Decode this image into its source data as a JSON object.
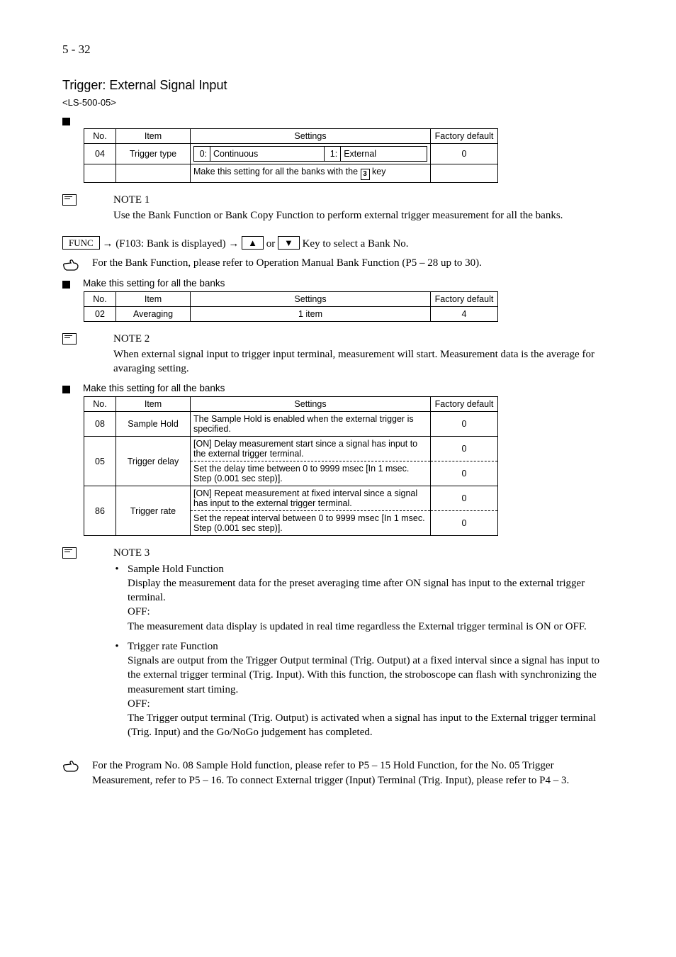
{
  "page_label": "5 - 32",
  "title": "Trigger: External Signal Input",
  "subtitle": "<LS-500-05>",
  "t1": {
    "headers": [
      "No.",
      "Item",
      "Settings",
      "Factory default"
    ],
    "row1": {
      "no": "04",
      "item": "Trigger type",
      "set_l_n": "0:",
      "set_l_v": "Continuous",
      "set_r_n": "1:",
      "set_r_v": "External",
      "def": "0"
    },
    "row2": {
      "no": "",
      "item": "",
      "desc": "Make this setting for all the banks with the ",
      "key": "3",
      "desc2": " key",
      "def": ""
    }
  },
  "note1_head": "NOTE 1",
  "note1_body": "Use the Bank Function or Bank Copy Function to perform external trigger measurement for all the banks.",
  "flow": {
    "k1": "FUNC",
    "mid": " → (F103: Bank is displayed) → ",
    "k2": "▲",
    "or": " or ",
    "k3": "▼",
    "tail": " Key to select a Bank No."
  },
  "bank_ref": "For the Bank Function, please refer to Operation Manual Bank Function (P5 – 28 up to 30).",
  "t2": {
    "title": "Make this setting for all the banks",
    "headers": [
      "No.",
      "Item",
      "Settings",
      "Factory default"
    ],
    "row": {
      "no": "02",
      "item": "Averaging",
      "settings": "1 item",
      "def": "4"
    }
  },
  "note2_head": "NOTE 2",
  "note2_body": "When external signal input to trigger input terminal, measurement will start. Measurement data is the average for avaraging setting.",
  "t3": {
    "title": "Make this setting for all the banks",
    "headers": [
      "No.",
      "Item",
      "Settings",
      "Factory default"
    ],
    "r1": {
      "no": "08",
      "item": "Sample Hold",
      "s": "The Sample Hold is enabled when the external trigger is specified.",
      "def": "0"
    },
    "r2": {
      "no": "05",
      "item": "Trigger delay",
      "s1": "[ON] Delay measurement start since a signal has input to the external trigger terminal.",
      "d1": "0",
      "s2": "Set the delay time between 0 to 9999 msec [In 1 msec. Step (0.001 sec step)].",
      "d2": "0"
    },
    "r3": {
      "no": "86",
      "item": "Trigger rate",
      "s1": "[ON] Repeat measurement at fixed interval since a signal has input to the external trigger terminal.",
      "d1": "0",
      "s2": "Set the repeat interval between 0 to 9999 msec [In 1 msec. Step (0.001 sec step)].",
      "d2": "0"
    }
  },
  "note3_head": "NOTE 3",
  "note3": {
    "b1_l1": "Sample Hold Function",
    "b1_l2": "Display the measurement data for the preset averaging time after ON signal has input to the external trigger terminal.",
    "b1_l3": "OFF:",
    "b1_l4": "The measurement data display is updated in real time regardless the External trigger terminal is ON or OFF.",
    "b2_l1": "Trigger rate Function",
    "b2_l2": "Signals are output from the Trigger Output terminal (Trig. Output) at a fixed interval since a signal has input to the external trigger terminal (Trig. Input). With this function, the stroboscope can flash with synchronizing the measurement start timing.",
    "b2_l3": "OFF:",
    "b2_l4": "The Trigger output terminal (Trig. Output) is activated when a signal has input to the External trigger terminal (Trig. Input) and the Go/NoGo judgement has completed."
  },
  "foot": "For the Program No. 08 Sample Hold function, please refer to P5 – 15 Hold Function, for the No. 05 Trigger Measurement, refer to P5 – 16. To connect External trigger (Input) Terminal (Trig. Input), please refer to P4 – 3."
}
